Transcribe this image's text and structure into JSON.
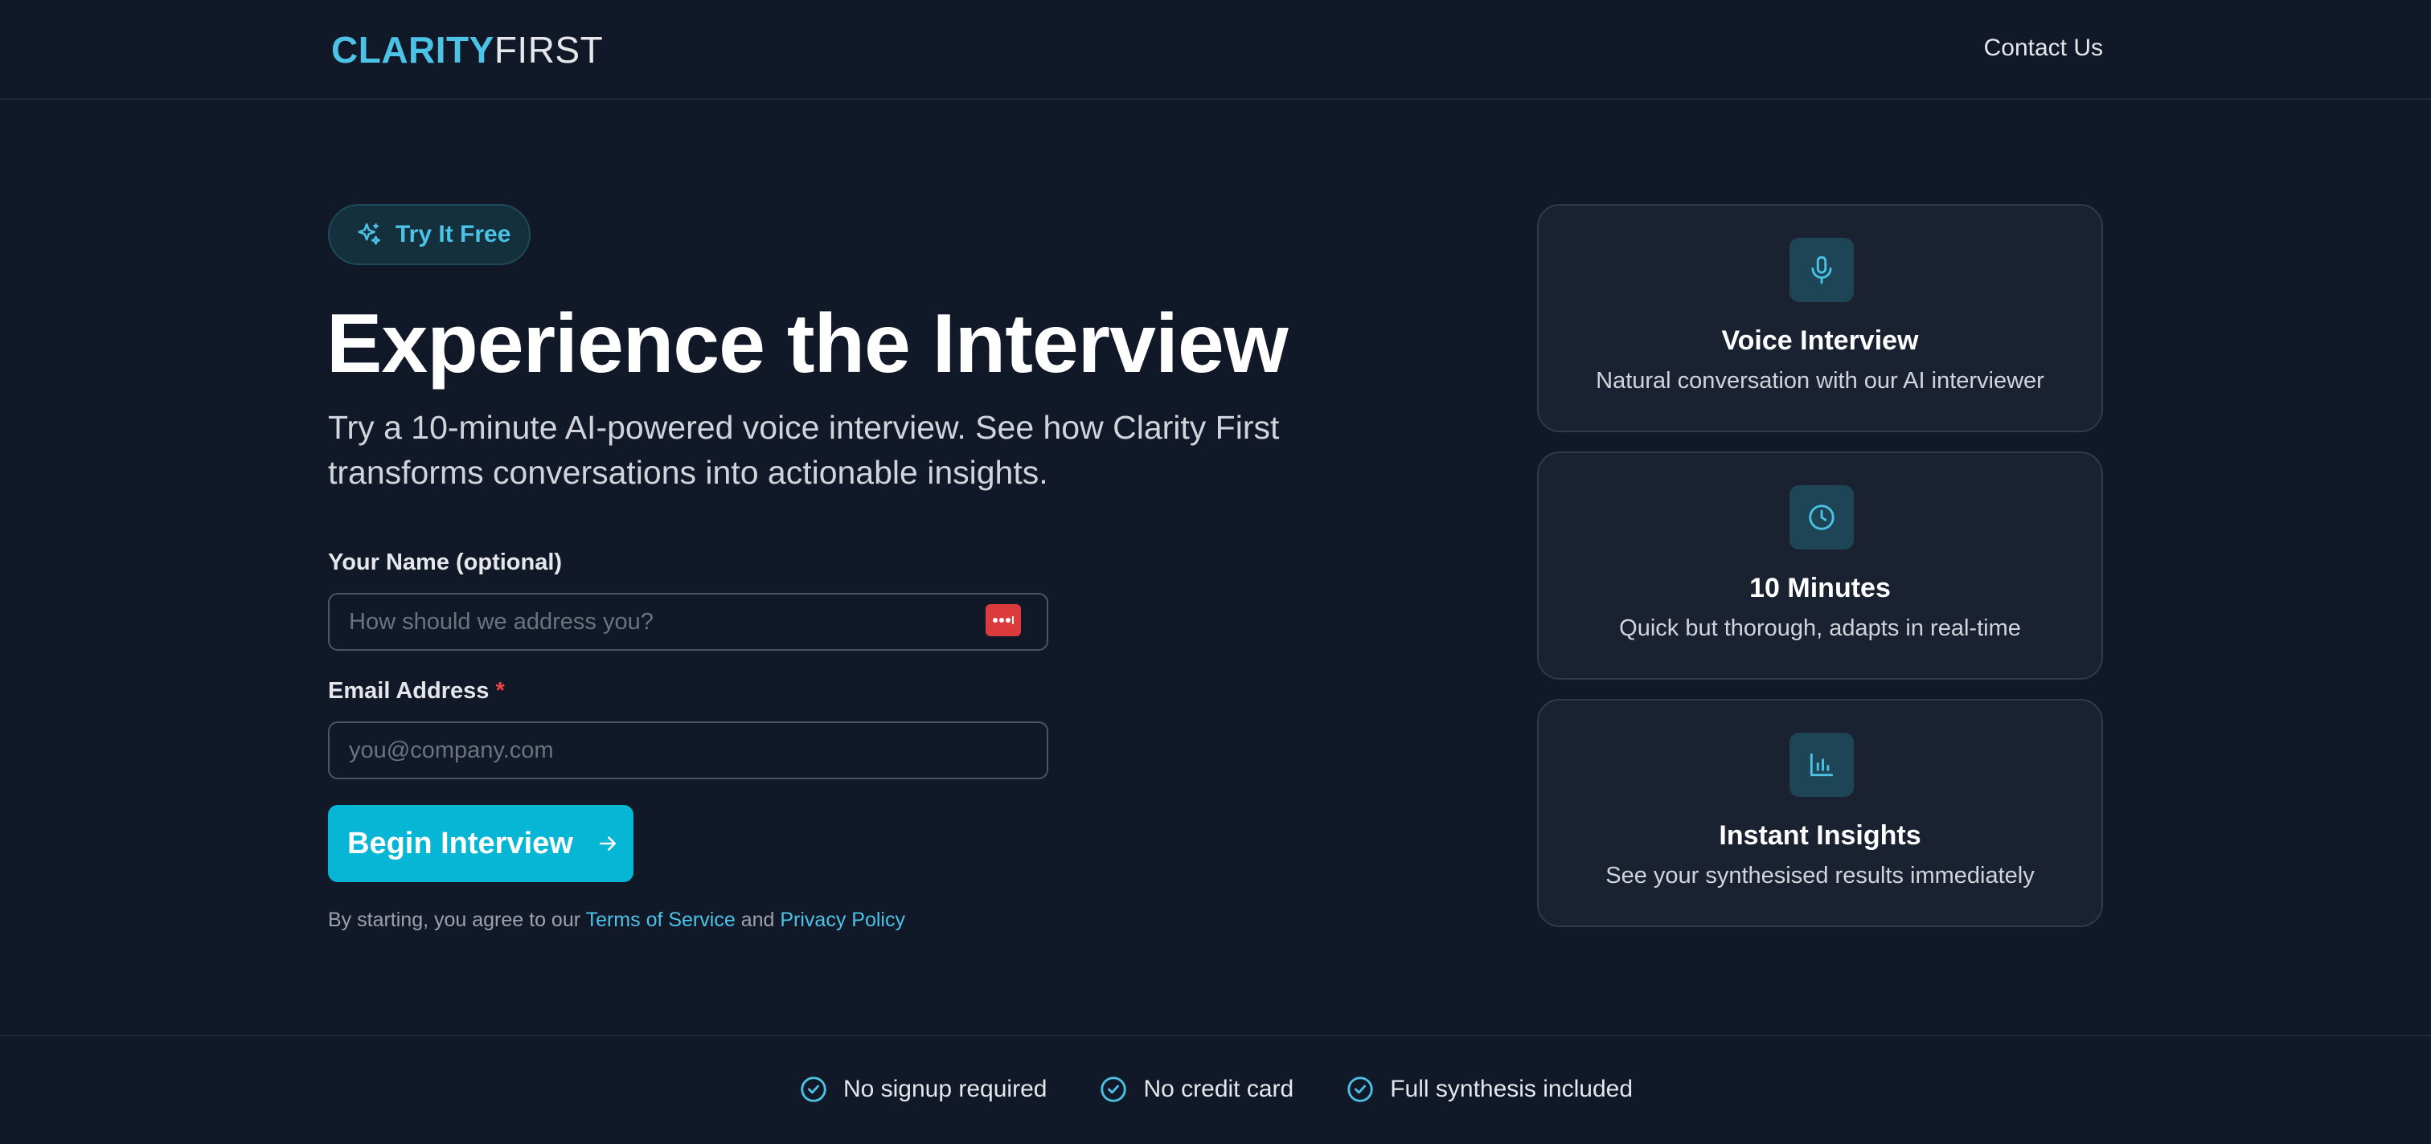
{
  "header": {
    "logo_bold": "CLARITY",
    "logo_light": "FIRST",
    "contact_label": "Contact Us"
  },
  "hero": {
    "badge_label": "Try It Free",
    "title": "Experience the Interview",
    "subtitle": "Try a 10-minute AI-powered voice interview. See how Clarity First transforms conversations into actionable insights."
  },
  "form": {
    "name_label": "Your Name (optional)",
    "name_placeholder": "How should we address you?",
    "name_value": "",
    "email_label": "Email Address",
    "email_required_mark": "*",
    "email_placeholder": "you@company.com",
    "email_value": "",
    "submit_label": "Begin Interview",
    "terms_prefix": "By starting, you agree to our",
    "terms_link": "Terms of Service",
    "terms_and": "and",
    "privacy_link": "Privacy Policy"
  },
  "features": [
    {
      "icon": "microphone-icon",
      "title": "Voice Interview",
      "desc": "Natural conversation with our AI interviewer"
    },
    {
      "icon": "clock-icon",
      "title": "10 Minutes",
      "desc": "Quick but thorough, adapts in real-time"
    },
    {
      "icon": "bar-chart-icon",
      "title": "Instant Insights",
      "desc": "See your synthesised results immediately"
    }
  ],
  "footer": {
    "items": [
      "No signup required",
      "No credit card",
      "Full synthesis included"
    ]
  },
  "colors": {
    "background": "#111827",
    "accent": "#06b6d4",
    "link": "#4cc3e6",
    "required": "#ef4444",
    "card_bg": "#1a2232"
  }
}
